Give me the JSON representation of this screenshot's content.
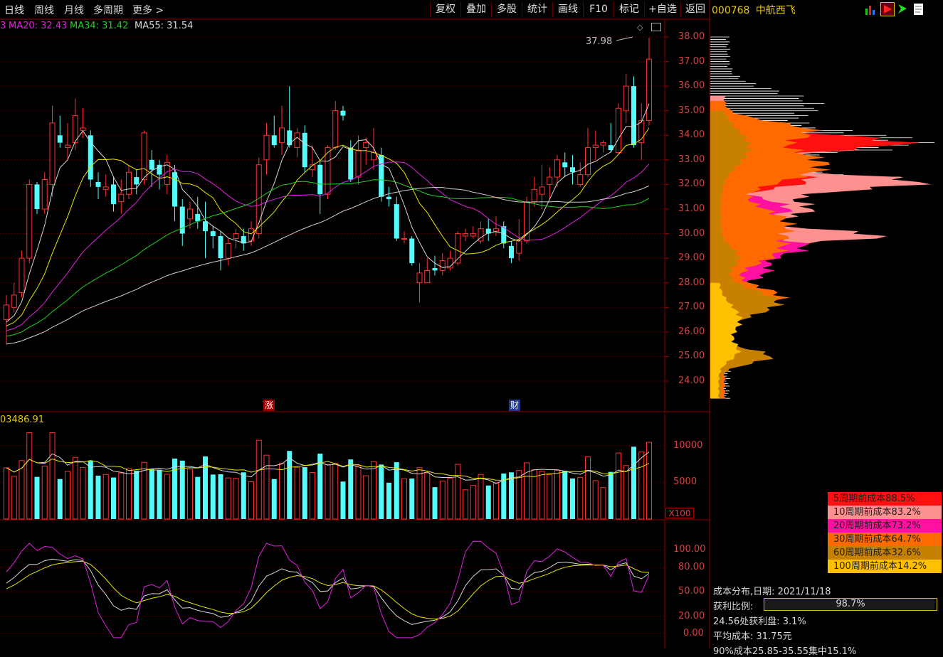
{
  "toolbar": {
    "periods": [
      "日线",
      "周线",
      "月线",
      "多周期",
      "更多 >"
    ],
    "buttons": [
      "复权",
      "叠加",
      "多股",
      "统计",
      "画线",
      "F10",
      "标记",
      "+自选",
      "返回"
    ]
  },
  "stock": {
    "code": "000768",
    "name": "中航西飞"
  },
  "ma_legend": [
    {
      "label": "MA20: 32.43",
      "color": "#e020e0"
    },
    {
      "label": "MA34: 31.42",
      "color": "#20d020"
    },
    {
      "label": "MA55: 31.54",
      "color": "#d8d8d8"
    }
  ],
  "price_axis": [
    "38.00",
    "37.00",
    "36.00",
    "35.00",
    "34.00",
    "33.00",
    "32.00",
    "31.00",
    "30.00",
    "29.00",
    "28.00",
    "27.00",
    "26.00",
    "25.00",
    "24.00"
  ],
  "max_price_label": "37.98",
  "flags": {
    "zhang": "涨",
    "cai": "财"
  },
  "volume": {
    "label": "03486.91",
    "axis": [
      "10000",
      "5000"
    ],
    "unit": "X100"
  },
  "kdj_axis": [
    "100.00",
    "80.00",
    "50.00",
    "20.00",
    "0.00"
  ],
  "cost_legend": [
    {
      "label": "5周期前成本88.5%",
      "color": "#ff1010"
    },
    {
      "label": "10周期前成本83.2%",
      "color": "#ff9090"
    },
    {
      "label": "20周期前成本73.2%",
      "color": "#ff10a0"
    },
    {
      "label": "30周期前成本64.7%",
      "color": "#ff6a00"
    },
    {
      "label": "60周期前成本32.6%",
      "color": "#c88000"
    },
    {
      "label": "100周期前成本14.2%",
      "color": "#ffc000"
    }
  ],
  "cost_info": {
    "date_line": "成本分布,日期:  2021/11/18",
    "profit_label": "获利比例:",
    "profit_value": "98.7%",
    "profit_fraction": 0.987,
    "line3": "24.56处获利盘:  3.1%",
    "line4": "平均成本:  31.75元",
    "line5": "90%成本25.85-35.55集中15.1%"
  },
  "chart_data": {
    "type": "candlestick",
    "candles": [
      {
        "o": 26.5,
        "c": 27.1,
        "h": 27.5,
        "l": 25.5
      },
      {
        "o": 27.0,
        "c": 27.5,
        "h": 28.0,
        "l": 26.8
      },
      {
        "o": 27.6,
        "c": 29.0,
        "h": 29.3,
        "l": 27.4
      },
      {
        "o": 29.0,
        "c": 32.0,
        "h": 32.2,
        "l": 28.8
      },
      {
        "o": 32.0,
        "c": 31.0,
        "h": 32.1,
        "l": 30.8
      },
      {
        "o": 31.0,
        "c": 32.2,
        "h": 32.5,
        "l": 30.8
      },
      {
        "o": 32.0,
        "c": 34.5,
        "h": 35.2,
        "l": 31.5
      },
      {
        "o": 34.0,
        "c": 33.7,
        "h": 34.8,
        "l": 33.5
      },
      {
        "o": 33.5,
        "c": 33.6,
        "h": 34.5,
        "l": 33.0
      },
      {
        "o": 33.7,
        "c": 34.8,
        "h": 35.5,
        "l": 33.4
      },
      {
        "o": 34.2,
        "c": 34.3,
        "h": 35.1,
        "l": 33.9
      },
      {
        "o": 34.0,
        "c": 32.2,
        "h": 34.2,
        "l": 31.9
      },
      {
        "o": 32.1,
        "c": 31.9,
        "h": 32.5,
        "l": 31.4
      },
      {
        "o": 31.8,
        "c": 31.9,
        "h": 32.4,
        "l": 31.5
      },
      {
        "o": 32.0,
        "c": 31.2,
        "h": 32.3,
        "l": 30.9
      },
      {
        "o": 31.3,
        "c": 31.6,
        "h": 32.2,
        "l": 30.8
      },
      {
        "o": 31.6,
        "c": 32.5,
        "h": 32.8,
        "l": 31.4
      },
      {
        "o": 32.3,
        "c": 32.0,
        "h": 32.6,
        "l": 31.6
      },
      {
        "o": 32.2,
        "c": 34.1,
        "h": 34.2,
        "l": 32.0
      },
      {
        "o": 33.0,
        "c": 32.6,
        "h": 33.4,
        "l": 31.9
      },
      {
        "o": 32.8,
        "c": 32.4,
        "h": 33.0,
        "l": 31.8
      },
      {
        "o": 32.0,
        "c": 32.9,
        "h": 33.2,
        "l": 31.6
      },
      {
        "o": 32.5,
        "c": 31.1,
        "h": 32.8,
        "l": 30.5
      },
      {
        "o": 31.1,
        "c": 30.0,
        "h": 31.4,
        "l": 29.5
      },
      {
        "o": 30.6,
        "c": 31.0,
        "h": 31.3,
        "l": 30.2
      },
      {
        "o": 30.8,
        "c": 30.5,
        "h": 31.5,
        "l": 30.2
      },
      {
        "o": 30.5,
        "c": 30.1,
        "h": 31.3,
        "l": 29.0
      },
      {
        "o": 30.1,
        "c": 29.9,
        "h": 30.3,
        "l": 29.4
      },
      {
        "o": 29.9,
        "c": 29.0,
        "h": 30.1,
        "l": 28.5
      },
      {
        "o": 29.0,
        "c": 29.6,
        "h": 29.8,
        "l": 28.7
      },
      {
        "o": 29.8,
        "c": 30.0,
        "h": 30.2,
        "l": 29.4
      },
      {
        "o": 29.9,
        "c": 29.6,
        "h": 30.2,
        "l": 29.3
      },
      {
        "o": 29.7,
        "c": 30.2,
        "h": 30.5,
        "l": 29.5
      },
      {
        "o": 30.0,
        "c": 32.8,
        "h": 33.1,
        "l": 29.8
      },
      {
        "o": 33.0,
        "c": 34.0,
        "h": 34.5,
        "l": 32.4
      },
      {
        "o": 34.0,
        "c": 33.6,
        "h": 34.8,
        "l": 33.5
      },
      {
        "o": 33.7,
        "c": 34.3,
        "h": 35.2,
        "l": 33.2
      },
      {
        "o": 34.2,
        "c": 33.6,
        "h": 36.0,
        "l": 33.5
      },
      {
        "o": 33.5,
        "c": 34.1,
        "h": 34.3,
        "l": 33.1
      },
      {
        "o": 34.1,
        "c": 32.7,
        "h": 34.4,
        "l": 32.5
      },
      {
        "o": 32.6,
        "c": 32.8,
        "h": 33.6,
        "l": 32.3
      },
      {
        "o": 32.8,
        "c": 31.6,
        "h": 33.0,
        "l": 30.8
      },
      {
        "o": 31.6,
        "c": 33.5,
        "h": 33.6,
        "l": 31.4
      },
      {
        "o": 33.5,
        "c": 35.0,
        "h": 35.4,
        "l": 33.4
      },
      {
        "o": 35.0,
        "c": 34.8,
        "h": 35.2,
        "l": 34.6
      },
      {
        "o": 33.5,
        "c": 32.2,
        "h": 33.8,
        "l": 32.1
      },
      {
        "o": 32.3,
        "c": 33.4,
        "h": 34.0,
        "l": 32.0
      },
      {
        "o": 33.5,
        "c": 33.7,
        "h": 33.9,
        "l": 32.8
      },
      {
        "o": 33.0,
        "c": 33.3,
        "h": 34.3,
        "l": 32.6
      },
      {
        "o": 33.2,
        "c": 31.5,
        "h": 33.5,
        "l": 31.3
      },
      {
        "o": 31.5,
        "c": 31.4,
        "h": 31.9,
        "l": 31.1
      },
      {
        "o": 31.2,
        "c": 29.8,
        "h": 31.5,
        "l": 29.7
      },
      {
        "o": 29.8,
        "c": 29.8,
        "h": 30.1,
        "l": 29.6
      },
      {
        "o": 29.8,
        "c": 28.8,
        "h": 29.9,
        "l": 28.7
      },
      {
        "o": 28.0,
        "c": 28.4,
        "h": 28.8,
        "l": 27.2
      },
      {
        "o": 28.0,
        "c": 28.5,
        "h": 29.0,
        "l": 28.0
      },
      {
        "o": 28.6,
        "c": 28.5,
        "h": 29.1,
        "l": 28.3
      },
      {
        "o": 28.5,
        "c": 28.9,
        "h": 29.2,
        "l": 28.3
      },
      {
        "o": 28.6,
        "c": 29.0,
        "h": 29.3,
        "l": 28.5
      },
      {
        "o": 28.8,
        "c": 30.0,
        "h": 30.1,
        "l": 28.7
      },
      {
        "o": 29.9,
        "c": 30.0,
        "h": 30.2,
        "l": 29.7
      },
      {
        "o": 29.9,
        "c": 30.0,
        "h": 30.3,
        "l": 29.8
      },
      {
        "o": 29.7,
        "c": 30.2,
        "h": 30.5,
        "l": 29.6
      },
      {
        "o": 30.2,
        "c": 30.0,
        "h": 30.6,
        "l": 29.7
      },
      {
        "o": 30.1,
        "c": 30.2,
        "h": 30.7,
        "l": 29.9
      },
      {
        "o": 30.3,
        "c": 29.6,
        "h": 30.5,
        "l": 29.4
      },
      {
        "o": 29.5,
        "c": 29.0,
        "h": 29.7,
        "l": 28.8
      },
      {
        "o": 29.2,
        "c": 29.7,
        "h": 30.6,
        "l": 28.9
      },
      {
        "o": 29.7,
        "c": 31.3,
        "h": 31.5,
        "l": 29.6
      },
      {
        "o": 31.3,
        "c": 31.8,
        "h": 32.3,
        "l": 31.1
      },
      {
        "o": 31.6,
        "c": 31.9,
        "h": 32.8,
        "l": 31.0
      },
      {
        "o": 32.0,
        "c": 32.3,
        "h": 32.7,
        "l": 31.4
      },
      {
        "o": 32.3,
        "c": 33.0,
        "h": 33.2,
        "l": 31.9
      },
      {
        "o": 32.9,
        "c": 32.7,
        "h": 33.3,
        "l": 32.3
      },
      {
        "o": 32.7,
        "c": 32.5,
        "h": 33.2,
        "l": 32.0
      },
      {
        "o": 32.0,
        "c": 32.4,
        "h": 32.9,
        "l": 31.9
      },
      {
        "o": 32.4,
        "c": 33.5,
        "h": 34.3,
        "l": 32.3
      },
      {
        "o": 33.5,
        "c": 33.6,
        "h": 34.2,
        "l": 33.0
      },
      {
        "o": 33.6,
        "c": 33.7,
        "h": 33.8,
        "l": 33.3
      },
      {
        "o": 33.6,
        "c": 33.4,
        "h": 34.5,
        "l": 33.3
      },
      {
        "o": 33.3,
        "c": 35.1,
        "h": 35.3,
        "l": 33.2
      },
      {
        "o": 35.0,
        "c": 36.0,
        "h": 36.5,
        "l": 34.5
      },
      {
        "o": 36.0,
        "c": 33.6,
        "h": 36.4,
        "l": 33.5
      },
      {
        "o": 33.7,
        "c": 34.6,
        "h": 35.3,
        "l": 33.0
      },
      {
        "o": 34.6,
        "c": 37.1,
        "h": 37.98,
        "l": 34.4
      }
    ]
  }
}
